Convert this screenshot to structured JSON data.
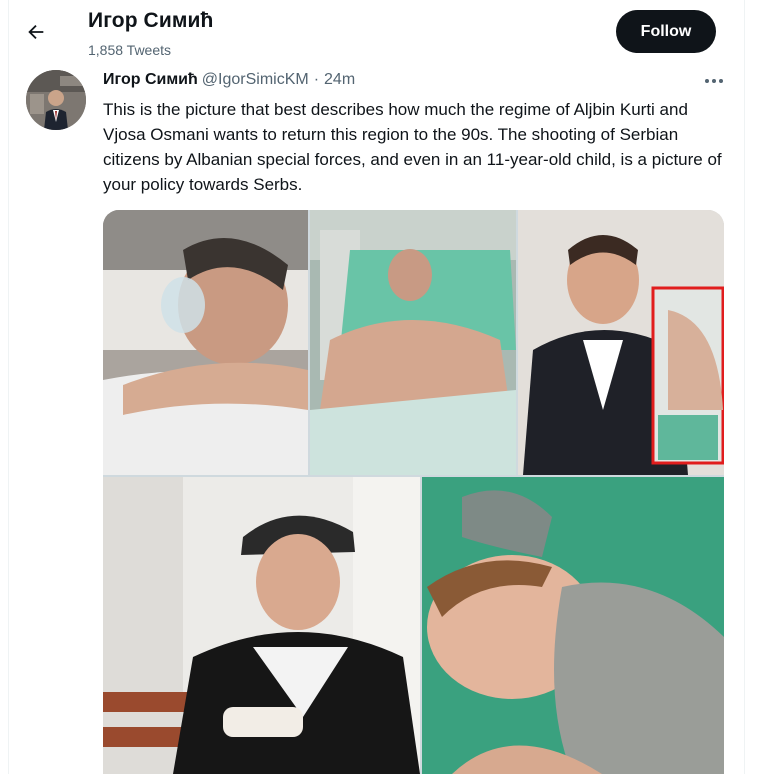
{
  "header": {
    "title": "Игор Симић",
    "tweet_count": "1,858 Tweets",
    "follow_label": "Follow",
    "back_icon": "arrow-left-icon"
  },
  "tweet": {
    "display_name": "Игор Симић",
    "handle": "@IgorSimicKM",
    "separator": "·",
    "time": "24m",
    "more_icon": "more-horizontal-icon",
    "text": "This is the picture that best describes how much the regime of Aljbin Kurti and Vjosa Osmani wants to return this region to the 90s.  The shooting of Serbian citizens by Albanian special forces, and even in an 11-year-old child, is a picture of your policy towards Serbs."
  },
  "media": {
    "photo_count": 5
  },
  "colors": {
    "text_primary": "#0f1419",
    "text_secondary": "#536471",
    "button_bg": "#0f1419",
    "button_text": "#ffffff",
    "border": "#eff3f4"
  }
}
